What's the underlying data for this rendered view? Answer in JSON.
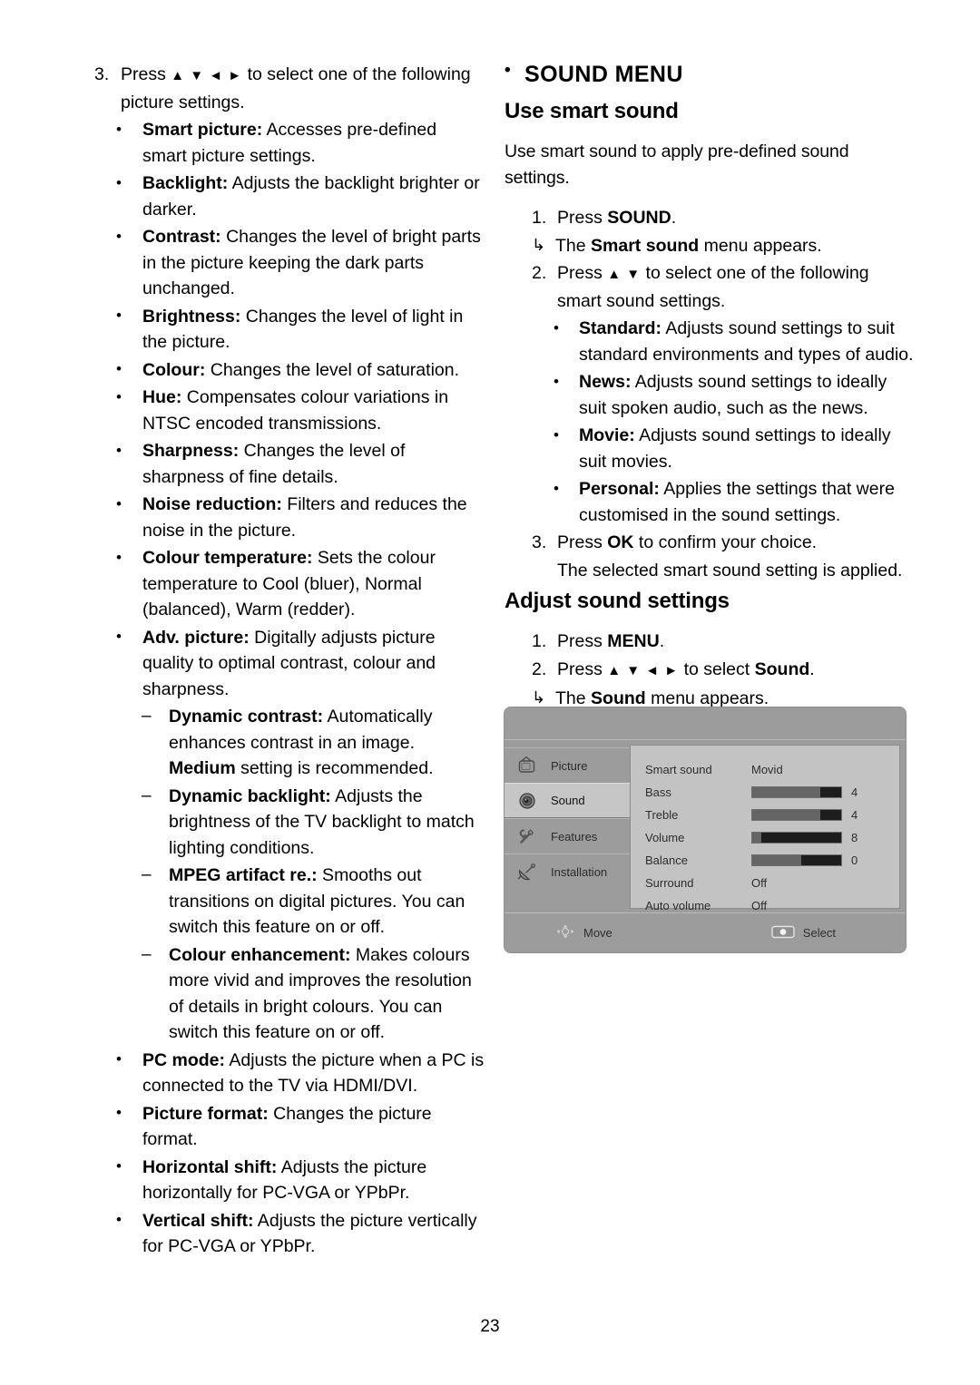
{
  "page": {
    "number": "23"
  },
  "left_column": {
    "step3": {
      "num": "3.",
      "text_a": "Press ",
      "arrows": "▲ ▼ ◄ ►",
      "text_b": " to select one of the following picture settings."
    },
    "bullets": [
      {
        "term": "Smart picture:",
        "desc": " Accesses pre-defined smart picture settings."
      },
      {
        "term": "Backlight:",
        "desc": " Adjusts the backlight brighter or darker."
      },
      {
        "term": "Contrast:",
        "desc": " Changes the level of bright parts in the picture keeping the dark parts unchanged."
      },
      {
        "term": "Brightness:",
        "desc": " Changes the level of light in the picture."
      },
      {
        "term": "Colour:",
        "desc": " Changes the level of saturation."
      },
      {
        "term": "Hue:",
        "desc": " Compensates colour variations in NTSC encoded transmissions."
      },
      {
        "term": "Sharpness:",
        "desc": " Changes the level of sharpness of fine details."
      },
      {
        "term": "Noise reduction:",
        "desc": " Filters and reduces the noise in the picture."
      },
      {
        "term": "Colour temperature:",
        "desc": " Sets the colour temperature to Cool (bluer), Normal (balanced), Warm (redder)."
      },
      {
        "term": "Adv. picture:",
        "desc": " Digitally adjusts picture quality to optimal contrast, colour and sharpness."
      }
    ],
    "sub_bullets": [
      {
        "term": "Dynamic contrast:",
        "desc": " Automatically enhances contrast in an image. ",
        "emph": "Medium",
        "desc2": " setting is recommended."
      },
      {
        "term": "Dynamic backlight:",
        "desc": " Adjusts the brightness of the TV backlight to match lighting conditions.",
        "emph": "",
        "desc2": ""
      },
      {
        "term": "MPEG artifact re.:",
        "desc": " Smooths out transitions on digital pictures. You can switch this feature on or off.",
        "emph": "",
        "desc2": ""
      },
      {
        "term": "Colour enhancement:",
        "desc": " Makes colours more vivid and improves the resolution of details in bright colours. You can switch this feature on or off.",
        "emph": "",
        "desc2": ""
      }
    ],
    "bullets_tail": [
      {
        "term": "PC mode:",
        "desc": " Adjusts the picture when a PC is connected to the TV via HDMI/DVI."
      },
      {
        "term": "Picture format:",
        "desc": " Changes the picture format."
      },
      {
        "term": "Horizontal shift:",
        "desc": " Adjusts the picture horizontally for PC-VGA or YPbPr."
      },
      {
        "term": "Vertical shift:",
        "desc": " Adjusts the picture vertically for PC-VGA or YPbPr."
      }
    ],
    "bullet_marker": "•",
    "dash_marker": "–"
  },
  "right_column": {
    "section_title": "SOUND MENU",
    "section_marker": "•",
    "heading_smart": "Use smart sound",
    "intro": "Use smart sound to apply pre-defined sound settings.",
    "smart_steps": {
      "s1_num": "1.",
      "s1_a": "Press ",
      "s1_bold": "SOUND",
      "s1_b": ".",
      "s1_res_marker": "↳",
      "s1_res_a": "The ",
      "s1_res_bold": "Smart sound",
      "s1_res_b": " menu appears.",
      "s2_num": "2.",
      "s2_a": "Press ",
      "s2_arrows": "▲ ▼",
      "s2_b": " to select one of the following smart sound settings.",
      "s3_num": "3.",
      "s3_a": "Press ",
      "s3_bold": "OK",
      "s3_b": " to confirm your choice.",
      "s3_cont": "The selected smart sound setting is applied."
    },
    "smart_options": [
      {
        "term": "Standard:",
        "desc": " Adjusts sound settings to suit standard environments and types of audio."
      },
      {
        "term": "News:",
        "desc": " Adjusts sound settings to ideally suit spoken audio, such as the news."
      },
      {
        "term": "Movie:",
        "desc": " Adjusts sound settings to ideally suit movies."
      },
      {
        "term": "Personal:",
        "desc": " Applies the settings that were customised in the sound settings."
      }
    ],
    "heading_adjust": "Adjust sound settings",
    "adjust_steps": {
      "a1_num": "1.",
      "a1_a": "Press ",
      "a1_bold": "MENU",
      "a1_b": ".",
      "a2_num": "2.",
      "a2_a": "Press ",
      "a2_arrows": "▲ ▼ ◄ ►",
      "a2_b": " to select ",
      "a2_bold": "Sound",
      "a2_c": ".",
      "a2_res_marker": "↳",
      "a2_res_a": "The ",
      "a2_res_bold": "Sound",
      "a2_res_b": " menu appears."
    },
    "bullet_marker": "•"
  },
  "osd": {
    "sidebar": [
      {
        "label": "Picture",
        "icon": "tv-icon",
        "selected": false
      },
      {
        "label": "Sound",
        "icon": "speaker-icon",
        "selected": true
      },
      {
        "label": "Features",
        "icon": "tools-icon",
        "selected": false
      },
      {
        "label": "Installation",
        "icon": "satellite-dish-icon",
        "selected": false
      }
    ],
    "rows": [
      {
        "name": "Smart sound",
        "type": "value",
        "value": "Movid"
      },
      {
        "name": "Bass",
        "type": "slider",
        "value": "4",
        "fill_pct": 77
      },
      {
        "name": "Treble",
        "type": "slider",
        "value": "4",
        "fill_pct": 77
      },
      {
        "name": "Volume",
        "type": "slider",
        "value": "8",
        "fill_pct": 10
      },
      {
        "name": "Balance",
        "type": "slider",
        "value": "0",
        "fill_pct": 55
      },
      {
        "name": "Surround",
        "type": "value",
        "value": "Off"
      },
      {
        "name": "Auto volume",
        "type": "value",
        "value": "Off"
      }
    ],
    "footer": {
      "move_label": "Move",
      "move_icon": "dpad-icon",
      "select_label": "Select",
      "select_icon": "ok-button-icon"
    },
    "colors": {
      "frame_bg": "#9c9c9c",
      "panel_bg": "#c3c3c3",
      "selected_bg": "#c6c6c6",
      "bar_track": "#1d1d1d",
      "bar_fill": "#656565"
    }
  }
}
